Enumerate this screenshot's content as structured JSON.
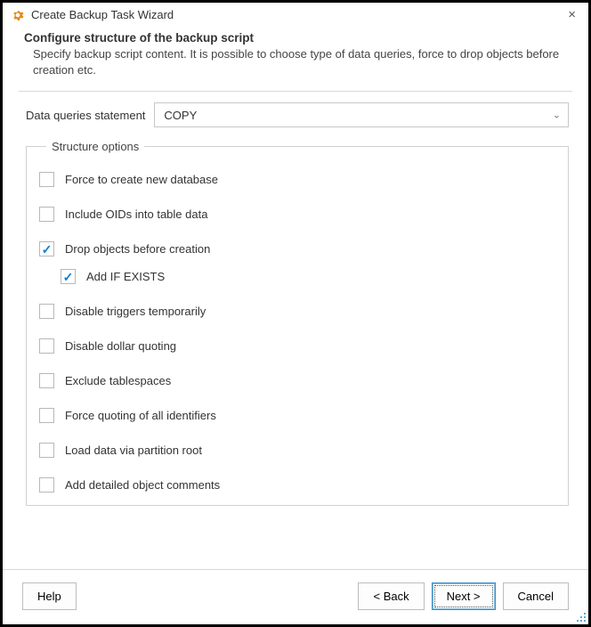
{
  "window": {
    "title": "Create Backup Task Wizard"
  },
  "header": {
    "heading": "Configure structure of the backup script",
    "subheading": "Specify backup script content. It is possible to choose type of data queries, force to drop objects before creation etc."
  },
  "fields": {
    "data_queries_label": "Data queries statement",
    "data_queries_value": "COPY"
  },
  "structure_options": {
    "legend": "Structure options",
    "items": [
      {
        "label": "Force to create new database",
        "checked": false
      },
      {
        "label": "Include OIDs into table data",
        "checked": false
      },
      {
        "label": "Drop objects before creation",
        "checked": true
      },
      {
        "label": "Add IF EXISTS",
        "checked": true,
        "sub": true
      },
      {
        "label": "Disable triggers temporarily",
        "checked": false
      },
      {
        "label": "Disable dollar quoting",
        "checked": false
      },
      {
        "label": "Exclude tablespaces",
        "checked": false
      },
      {
        "label": "Force quoting of all identifiers",
        "checked": false
      },
      {
        "label": "Load data via partition root",
        "checked": false
      },
      {
        "label": "Add detailed object comments",
        "checked": false
      }
    ]
  },
  "buttons": {
    "help": "Help",
    "back": "< Back",
    "next": "Next >",
    "cancel": "Cancel"
  }
}
